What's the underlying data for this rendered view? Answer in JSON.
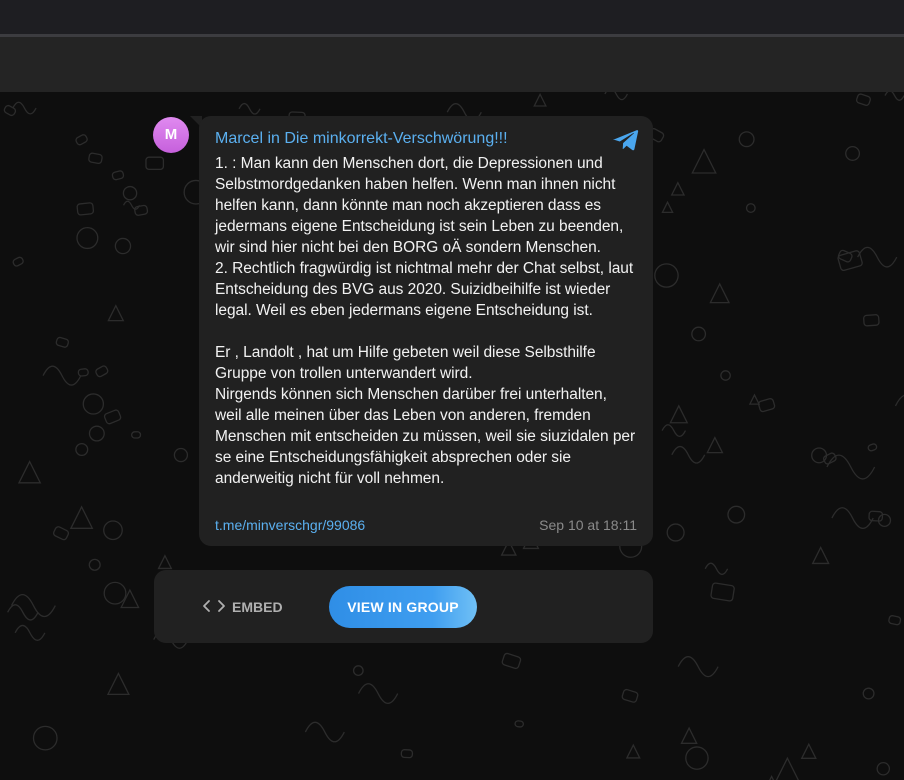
{
  "avatar": {
    "initial": "M",
    "color": "#d276e8"
  },
  "message": {
    "author": "Marcel",
    "in_word": "in",
    "chat_title": "Die minkorrekt-Verschwörung!!!",
    "source_icon": "telegram-icon",
    "paragraphs": [
      "1. : Man kann den Menschen dort, die Depressionen und Selbstmordgedanken haben helfen. Wenn man ihnen nicht helfen kann, dann könnte man noch akzeptieren dass es jedermans eigene Entscheidung ist sein Leben zu beenden, wir sind hier nicht bei den BORG oÄ sondern Menschen.\n2. Rechtlich fragwürdig ist nichtmal mehr der Chat selbst, laut Entscheidung des BVG aus 2020. Suizidbeihilfe ist wieder legal. Weil es eben jedermans eigene Entscheidung ist.",
      "Er , Landolt , hat um Hilfe gebeten weil diese Selbsthilfe Gruppe von trollen unterwandert wird.\nNirgends können sich Menschen darüber frei unterhalten, weil alle meinen über das Leben von anderen, fremden Menschen mit entscheiden zu müssen, weil sie siuzidalen per se eine Entscheidungsfähigkeit absprechen oder sie anderweitig nicht für voll nehmen."
    ],
    "link": "t.me/minverschgr/99086",
    "date": "Sep 10 at 18:11"
  },
  "actions": {
    "embed_label": "EMBED",
    "embed_icon": "code-brackets-icon",
    "view_label": "VIEW IN GROUP"
  },
  "colors": {
    "accent": "#5bb0f0",
    "bubble": "#212121",
    "button": "#3a9aef"
  }
}
